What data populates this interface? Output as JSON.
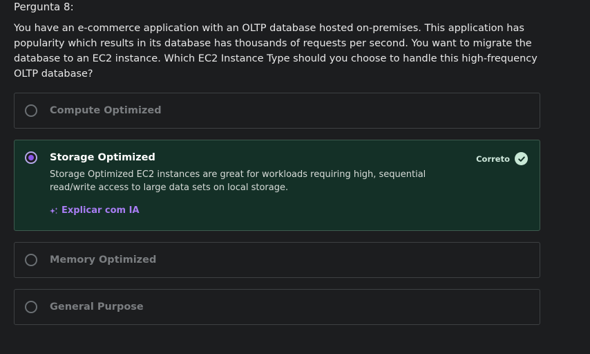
{
  "question": {
    "label": "Pergunta 8:",
    "text": "You have an e-commerce application with an OLTP database hosted on-premises. This application has popularity which results in its database has thousands of requests per second. You want to migrate the database to an EC2 instance. Which EC2 Instance Type should you choose to handle this high-frequency OLTP database?"
  },
  "options": [
    {
      "label": "Compute Optimized",
      "selected": false
    },
    {
      "label": "Storage Optimized",
      "selected": true,
      "status": "Correto",
      "explanation": "Storage Optimized EC2 instances are great for workloads requiring high, sequential read/write access to large data sets on local storage.",
      "ai_link": "Explicar com IA"
    },
    {
      "label": "Memory Optimized",
      "selected": false
    },
    {
      "label": "General Purpose",
      "selected": false
    }
  ],
  "icons": {
    "radio": "radio-button-icon",
    "check": "checkmark-circle-icon",
    "ai": "sparkle-icon"
  },
  "colors": {
    "background": "#1c1d1f",
    "selected_background": "#143027",
    "accent_purple": "#a77df2",
    "radio_checked": "#8a55e8",
    "correct_check_bg": "#c8e8d6"
  }
}
